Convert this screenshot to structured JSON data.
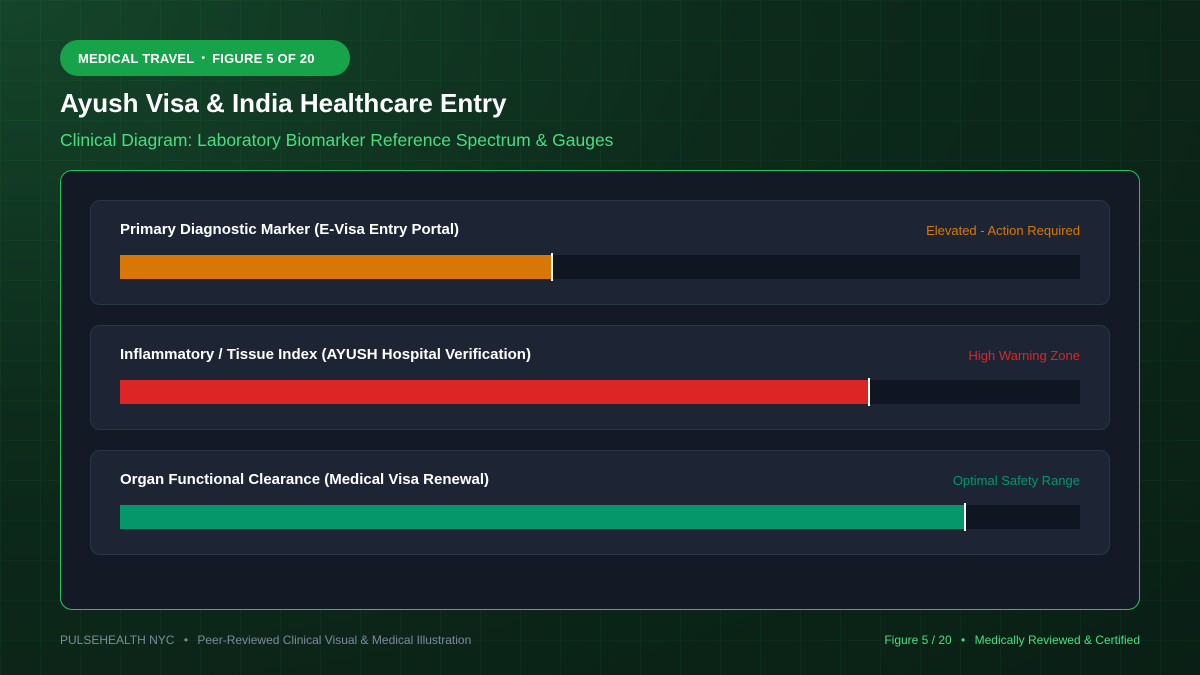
{
  "header": {
    "category": "MEDICAL TRAVEL",
    "figure_tag": "FIGURE 5 OF 20",
    "separator": "•",
    "title": "Ayush Visa & India Healthcare Entry",
    "subtitle": "Clinical Diagram: Laboratory Biomarker Reference Spectrum & Gauges"
  },
  "gauges": [
    {
      "label": "Primary Diagnostic Marker (E-Visa Entry Portal)",
      "status": "Elevated - Action Required",
      "value": 0.45,
      "color": "#d97706"
    },
    {
      "label": "Inflammatory / Tissue Index (AYUSH Hospital Verification)",
      "status": "High Warning Zone",
      "value": 0.78,
      "color": "#dc2626"
    },
    {
      "label": "Organ Functional Clearance (Medical Visa Renewal)",
      "status": "Optimal Safety Range",
      "value": 0.88,
      "color": "#059669"
    }
  ],
  "footer": {
    "brand": "PULSEHEALTH NYC",
    "separator": "•",
    "tagline": "Peer-Reviewed Clinical Visual & Medical Illustration",
    "figure": "Figure 5 / 20",
    "certification": "Medically Reviewed & Certified"
  },
  "colors": {
    "accent": "#22c55e",
    "pill": "#16a34a",
    "subtitle": "#4ade80"
  }
}
